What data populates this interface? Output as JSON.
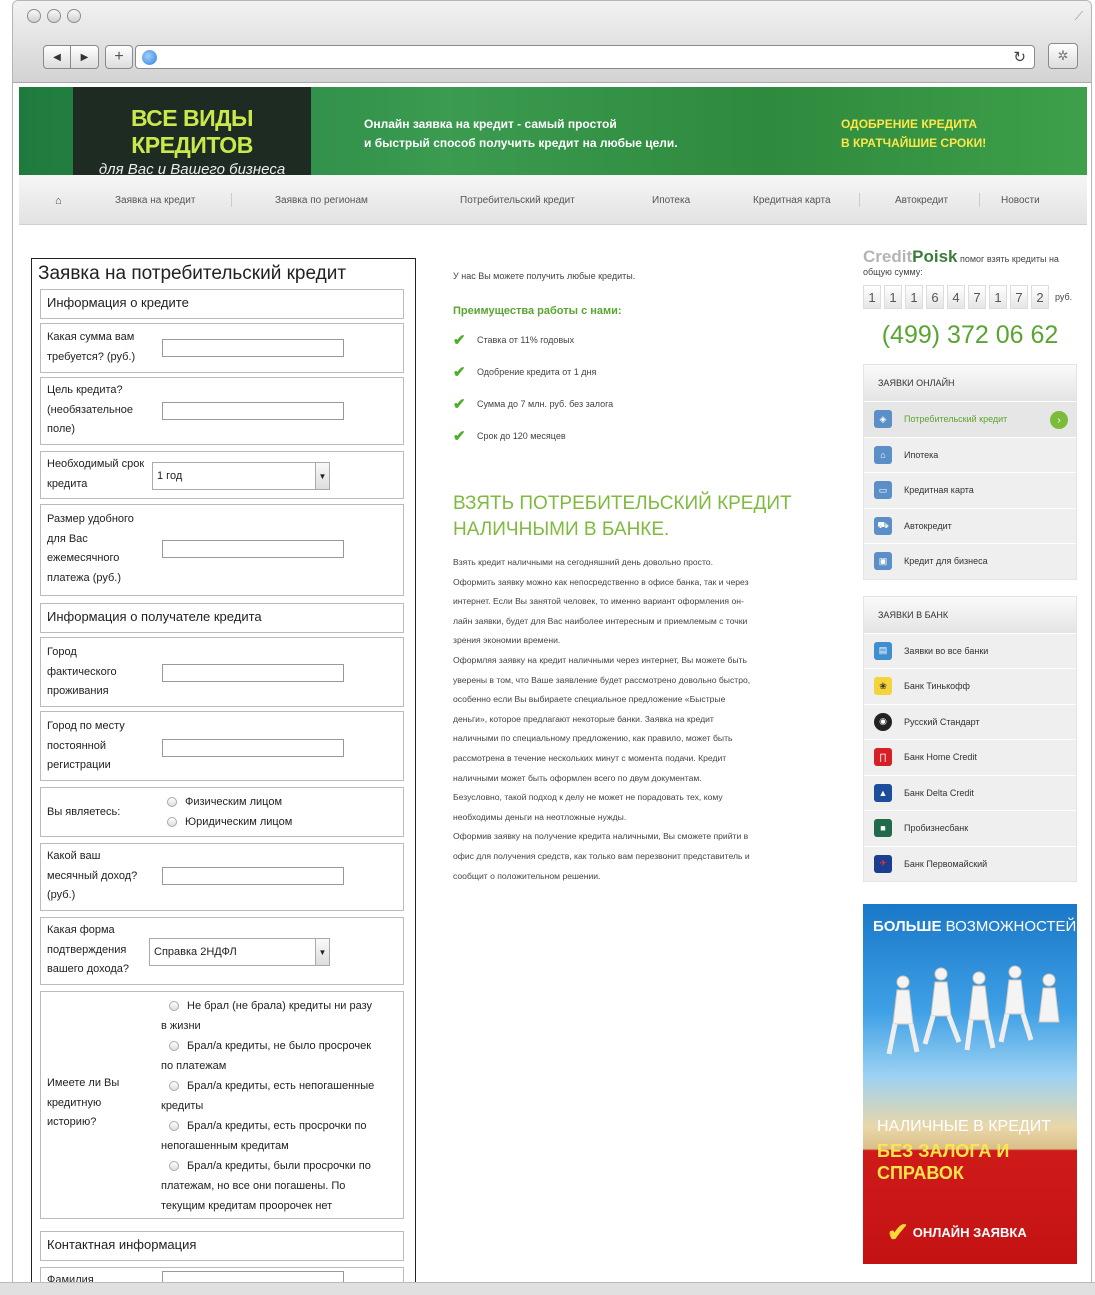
{
  "browser": {
    "reload_label": "↻"
  },
  "banner": {
    "logo_title": "ВСЕ ВИДЫ КРЕДИТОВ",
    "logo_sub": "для Вас и Вашего бизнеса",
    "mid_line1": "Онлайн заявка на кредит - самый простой",
    "mid_line2": "и быстрый способ получить кредит на любые цели.",
    "right_line1": "ОДОБРЕНИЕ КРЕДИТА",
    "right_line2": "В КРАТЧАЙШИЕ СРОКИ!"
  },
  "menu": [
    "Заявка на кредит",
    "Заявка по регионам",
    "Потребительский кредит",
    "Ипотека",
    "Кредитная карта",
    "Автокредит",
    "Новости"
  ],
  "form": {
    "title": "Заявка на потребительский кредит",
    "sec_credit": "Информация о кредите",
    "amount_label": [
      "Какая сумма вам",
      "требуется? (руб.)"
    ],
    "purpose_label": [
      "Цель кредита?",
      "(необязательное",
      "поле)"
    ],
    "term_label": [
      "Необходимый срок",
      "кредита"
    ],
    "term_value": "1 год",
    "payment_label": [
      "Размер удобного",
      "для Вас",
      "ежемесячного",
      "платежа (руб.)"
    ],
    "sec_recipient": "Информация о получателе кредита",
    "city_label": [
      "Город",
      "фактического",
      "проживания"
    ],
    "reg_label": [
      "Город по месту",
      "постоянной",
      "регистрации"
    ],
    "you_are_label": "Вы являетесь:",
    "you_are_options": [
      "Физическим лицом",
      "Юридическим лицом"
    ],
    "income_label": [
      "Какой ваш",
      "месячный доход?",
      "(руб.)"
    ],
    "proof_label": [
      "Какая форма",
      "подтверждения",
      "вашего дохода?"
    ],
    "proof_value": "Справка 2НДФЛ",
    "history_label": [
      "Имеете ли Вы",
      "кредитную",
      "историю?"
    ],
    "history_options": [
      [
        "Не брал (не брала) кредиты ни разу",
        "в жизни"
      ],
      [
        "Брал/а кредиты, не было просрочек",
        "по платежам"
      ],
      [
        "Брал/а кредиты, есть непогашенные",
        "кредиты"
      ],
      [
        "Брал/а кредиты, есть просрочки по",
        "непогашенным кредитам"
      ],
      [
        "Брал/а кредиты, были просрочки по",
        "платежам, но все они погашены. По",
        "текущим кредитам проорочек нет"
      ]
    ],
    "sec_contact": "Контактная информация",
    "surname_label": "Фамилия"
  },
  "middle": {
    "intro": "У нас Вы можете получить любые кредиты.",
    "adv_title": "Преимущества работы с нами:",
    "advantages": [
      "Ставка от 11% годовых",
      "Одобрение кредита от 1 дня",
      "Сумма до 7 млн. руб. без залога",
      "Срок до 120 месяцев"
    ],
    "h2_line1": "ВЗЯТЬ ПОТРЕБИТЕЛЬСКИЙ КРЕДИТ",
    "h2_line2": "НАЛИЧНЫМИ В БАНКЕ.",
    "para_lines": [
      "Взять кредит наличными на сегодняшний день довольно просто.",
      "Оформить заявку можно как непосредственно в офисе банка, так и через",
      "интернет. Если Вы занятой человек, то именно вариант оформления он-",
      "лайн заявки, будет для Вас наиболее интересным и приемлемым с точки",
      "зрения экономии времени.",
      "Оформляя заявку на кредит наличными через интернет, Вы можете быть",
      "уверены в том, что Ваше заявление будет рассмотрено довольно быстро,",
      "особенно если Вы выбираете специальное предложение «Быстрые",
      "деньги», которое предлагают некоторые банки. Заявка на кредит",
      "наличными по специальному предложению, как правило, может быть",
      "рассмотрена в течение нескольких минут с момента подачи. Кредит",
      "наличными может быть оформлен всего по двум документам.",
      "Безусловно, такой подход к делу не может не порадовать тех, кому",
      "необходимы деньги на неотложные нужды.",
      "Оформив заявку на получение кредита наличными, Вы сможете прийти в",
      "офис для получения средств, как только вам перезвонит представитель и",
      "сообщит о положительном решении."
    ]
  },
  "right": {
    "logo_a": "Credit",
    "logo_b": "Poisk",
    "sub_tail": " помог взять кредиты на",
    "sub_line2": "общую сумму:",
    "digits": [
      "1",
      "1",
      "1",
      "6",
      "4",
      "7",
      "1",
      "7",
      "2"
    ],
    "currency": "руб.",
    "phone": "(499) 372 06 62",
    "online_head": "ЗАЯВКИ ОНЛАЙН",
    "online_items": [
      "Потребительский кредит",
      "Ипотека",
      "Кредитная карта",
      "Автокредит",
      "Кредит для бизнеса"
    ],
    "bank_head": "ЗАЯВКИ В БАНК",
    "bank_items": [
      "Заявки во все банки",
      "Банк Тинькофф",
      "Русский Стандарт",
      "Банк Home Credit",
      "Банк Delta Credit",
      "Пробизнесбанк",
      "Банк Первомайский"
    ],
    "ad_top_bold": "БОЛЬШЕ",
    "ad_top_rest": " ВОЗМОЖНОСТЕЙ",
    "ad_mid": "НАЛИЧНЫЕ В КРЕДИТ",
    "ad_bold1": "БЕЗ ЗАЛОГА И",
    "ad_bold2": "СПРАВОК",
    "ad_btn": "ОНЛАЙН ЗАЯВКА"
  }
}
